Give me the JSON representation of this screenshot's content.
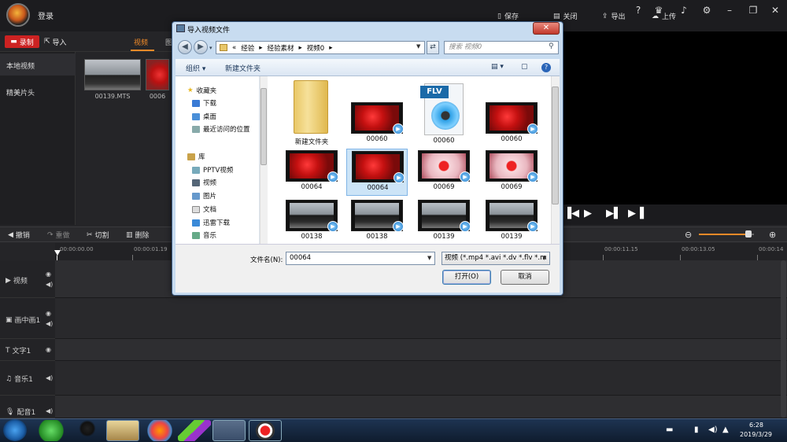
{
  "app": {
    "login": "登录"
  },
  "topbar": {
    "save": "保存",
    "close": "关闭",
    "export": "导出",
    "upload": "上传",
    "help": "?"
  },
  "toolbar": {
    "record": "录制",
    "import": "导入"
  },
  "media_tabs": {
    "video": "视频",
    "image": "图"
  },
  "left_panel": {
    "items": [
      "本地视频",
      "精美片头"
    ]
  },
  "media": {
    "items": [
      {
        "label": "00139.MTS"
      },
      {
        "label": "0006"
      }
    ]
  },
  "edit_tools": {
    "undo": "撤销",
    "redo": "重做",
    "cut": "切割",
    "delete": "删除"
  },
  "ruler": {
    "labels": [
      "00:00:00.00",
      "00:00:01.19",
      "00:00:11.15",
      "00:00:13.05",
      "00:00:14"
    ]
  },
  "tracks": [
    {
      "label": "视频"
    },
    {
      "label": "画中画1"
    },
    {
      "label": "文字1"
    },
    {
      "label": "音乐1"
    },
    {
      "label": "配音1"
    }
  ],
  "taskbar": {
    "time": "6:28",
    "date": "2019/3/29"
  },
  "dialog": {
    "title": "导入视频文件",
    "close": "✕",
    "address": {
      "prefix": "«",
      "crumbs": [
        "经验",
        "经验素材",
        "视频0"
      ]
    },
    "search_placeholder": "搜索 视频0",
    "commands": {
      "organize": "组织 ▾",
      "new_folder": "新建文件夹"
    },
    "nav": {
      "favorites": "收藏夹",
      "fav_items": [
        "下载",
        "桌面",
        "最近访问的位置"
      ],
      "library": "库",
      "lib_items": [
        "PPTV视频",
        "视频",
        "图片",
        "文档",
        "迅雷下载",
        "音乐"
      ]
    },
    "files": [
      {
        "name": "新建文件夹",
        "kind": "folder"
      },
      {
        "name": "00060",
        "kind": "red"
      },
      {
        "name": "00060",
        "kind": "flv"
      },
      {
        "name": "00060",
        "kind": "red"
      },
      {
        "name": "00064",
        "kind": "red"
      },
      {
        "name": "00064",
        "kind": "red",
        "selected": true
      },
      {
        "name": "00069",
        "kind": "pink"
      },
      {
        "name": "00069",
        "kind": "pink"
      },
      {
        "name": "00138",
        "kind": "car"
      },
      {
        "name": "00138",
        "kind": "car"
      },
      {
        "name": "00139",
        "kind": "car"
      },
      {
        "name": "00139",
        "kind": "car"
      }
    ],
    "flv_label": "FLV",
    "filename_label": "文件名(N):",
    "filename_value": "00064",
    "filter_value": "视频 (*.mp4 *.avi *.dv *.flv *.m",
    "open": "打开(O)",
    "cancel": "取消"
  },
  "colors": {
    "accent": "#f08a28",
    "record": "#cc2222",
    "dialog_frame": "#c8dcf0",
    "selection": "#cce4f7"
  }
}
